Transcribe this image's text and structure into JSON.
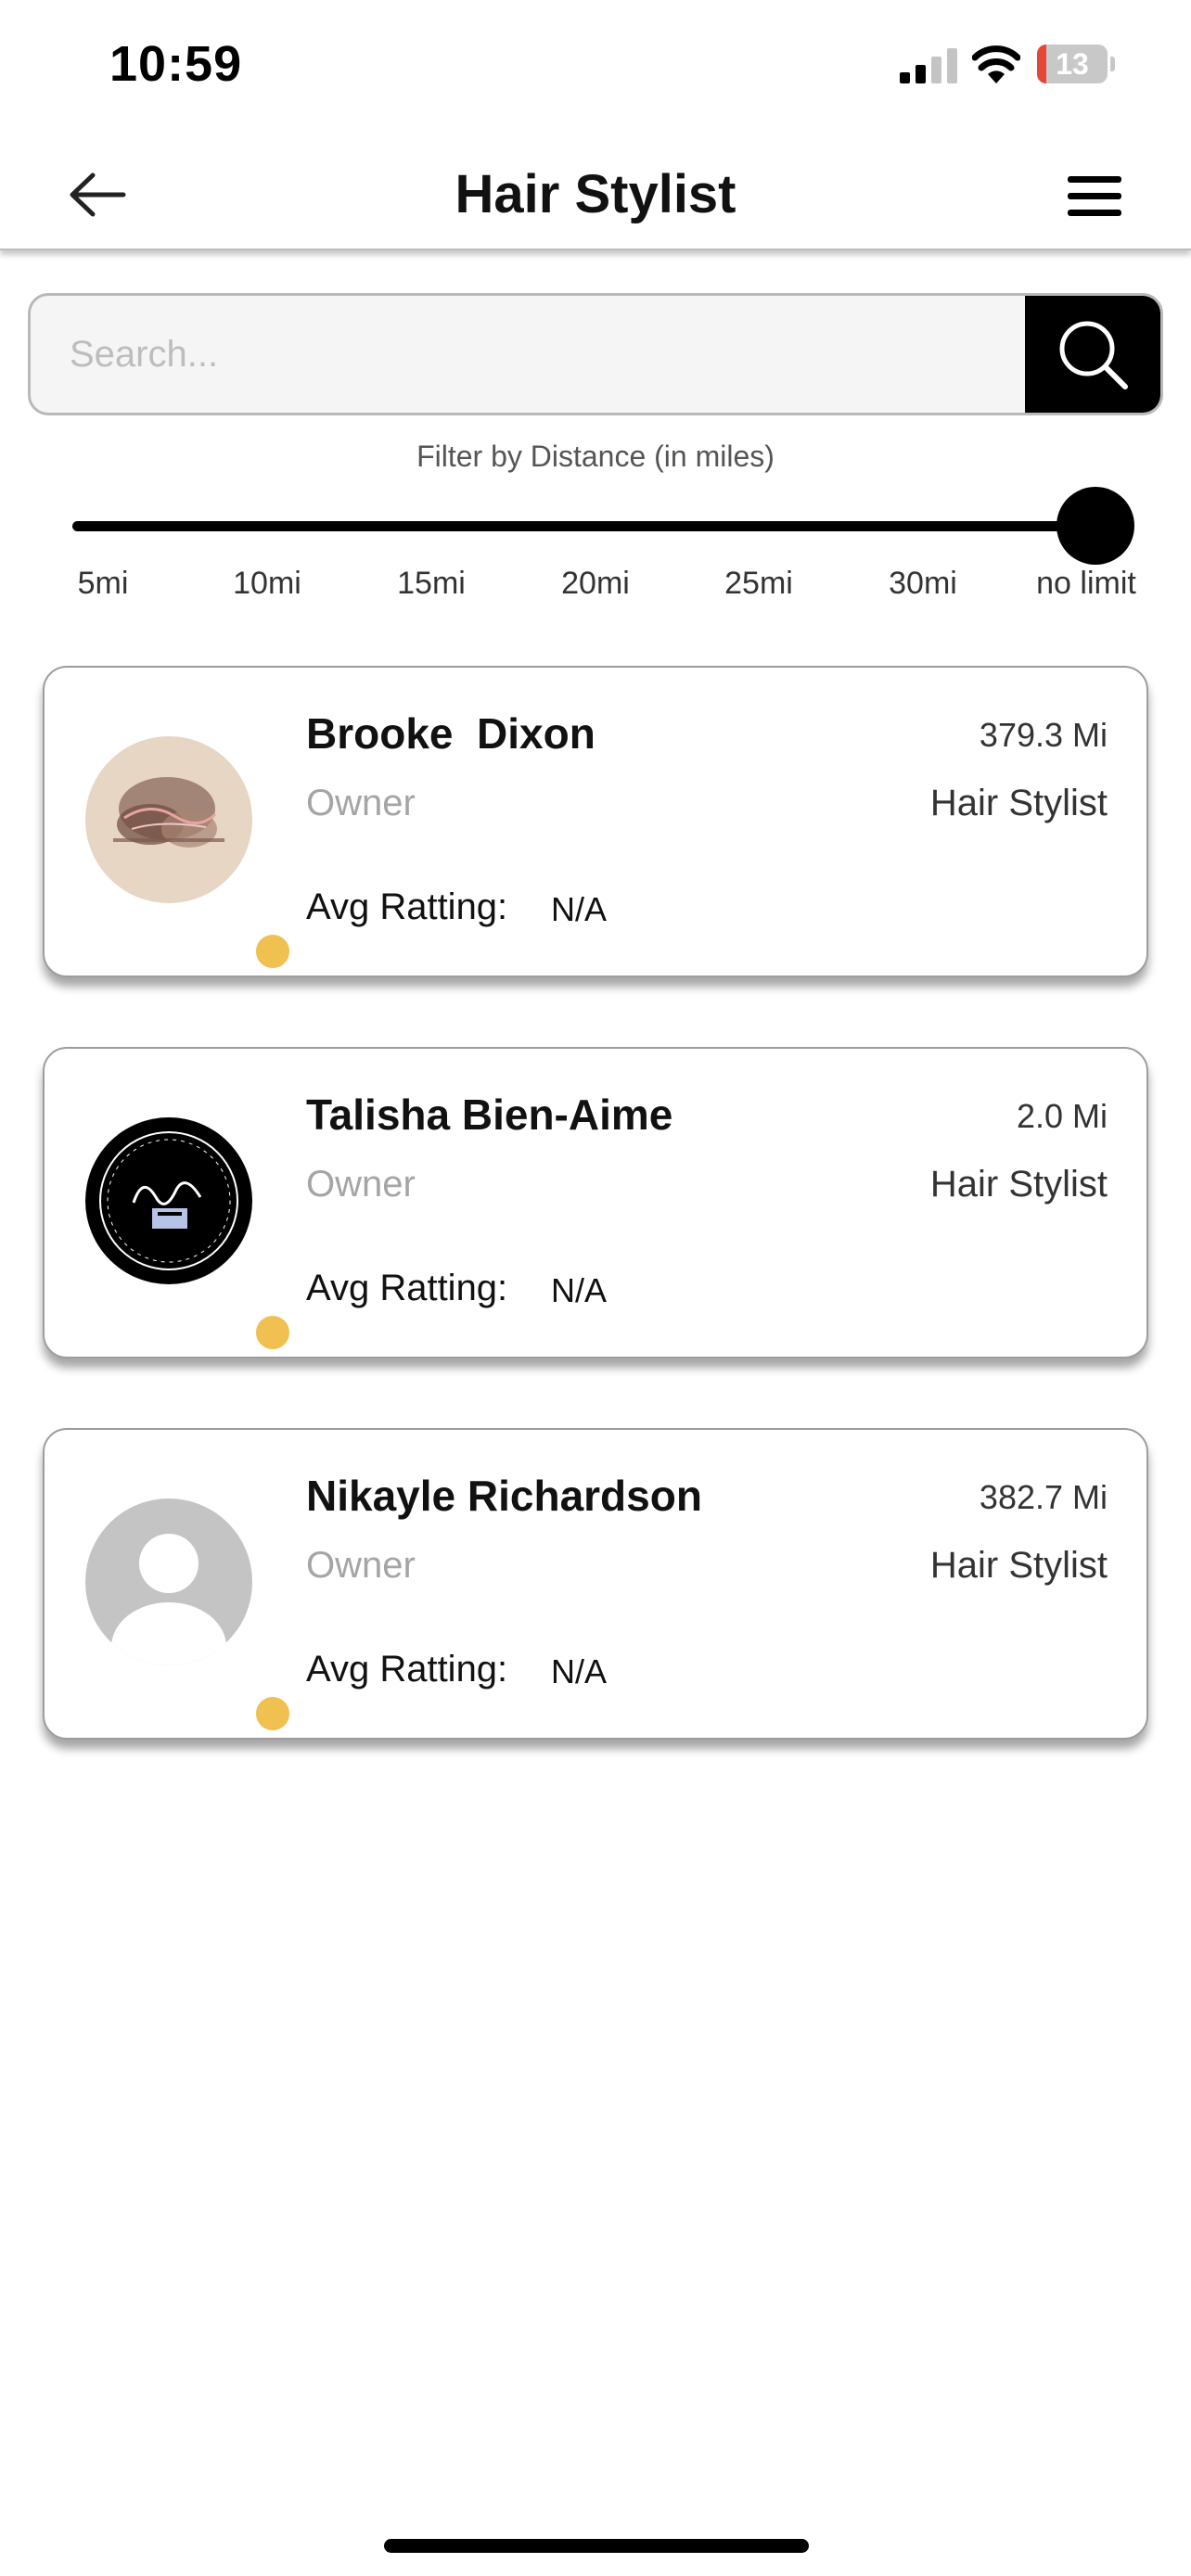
{
  "status_bar": {
    "time": "10:59",
    "battery_level": "13",
    "battery_fraction": 0.13,
    "battery_color": "#e5473b"
  },
  "header": {
    "title": "Hair Stylist",
    "back_icon": "arrow-left-icon",
    "menu_icon": "hamburger-menu-icon"
  },
  "search": {
    "placeholder": "Search...",
    "value": "",
    "icon": "search-icon"
  },
  "filter": {
    "label": "Filter by Distance (in miles)",
    "options": [
      "5mi",
      "10mi",
      "15mi",
      "20mi",
      "25mi",
      "30mi",
      "no limit"
    ],
    "selected_index": 6,
    "selected": "no limit"
  },
  "stylists": [
    {
      "name": "Brooke  Dixon",
      "distance": "379.3 Mi",
      "role": "Owner",
      "category": "Hair Stylist",
      "rating_label": "Avg Ratting:",
      "rating_value": "N/A",
      "avatar": "logo-beige-watercolor",
      "status_color": "#f0c050"
    },
    {
      "name": "Talisha Bien-Aime",
      "distance": "2.0 Mi",
      "role": "Owner",
      "category": "Hair Stylist",
      "rating_label": "Avg Ratting:",
      "rating_value": "N/A",
      "avatar": "logo-black-circle",
      "status_color": "#f0c050"
    },
    {
      "name": "Nikayle Richardson",
      "distance": "382.7 Mi",
      "role": "Owner",
      "category": "Hair Stylist",
      "rating_label": "Avg Ratting:",
      "rating_value": "N/A",
      "avatar": "default-user-icon",
      "status_color": "#f0c050"
    }
  ]
}
